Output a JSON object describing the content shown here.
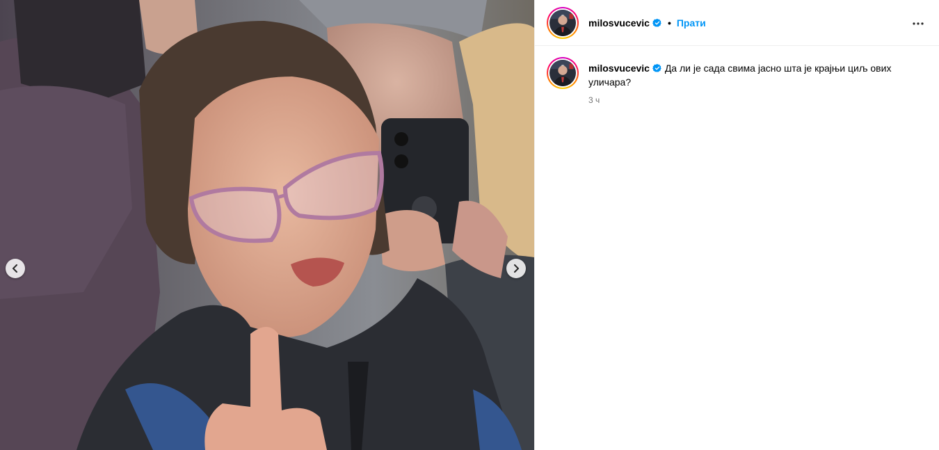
{
  "post": {
    "username": "milosvucevic",
    "separator": "•",
    "follow_label": "Прати",
    "caption": "Да ли је сада свима јасно шта је крајњи циљ ових уличара?",
    "time": "3 ч"
  },
  "icons": {
    "verified": "verified-badge-icon",
    "more": "more-options-icon",
    "prev": "chevron-left-icon",
    "next": "chevron-right-icon"
  },
  "colors": {
    "accent": "#0095f6",
    "muted": "#737373",
    "verified": "#0095f6"
  }
}
